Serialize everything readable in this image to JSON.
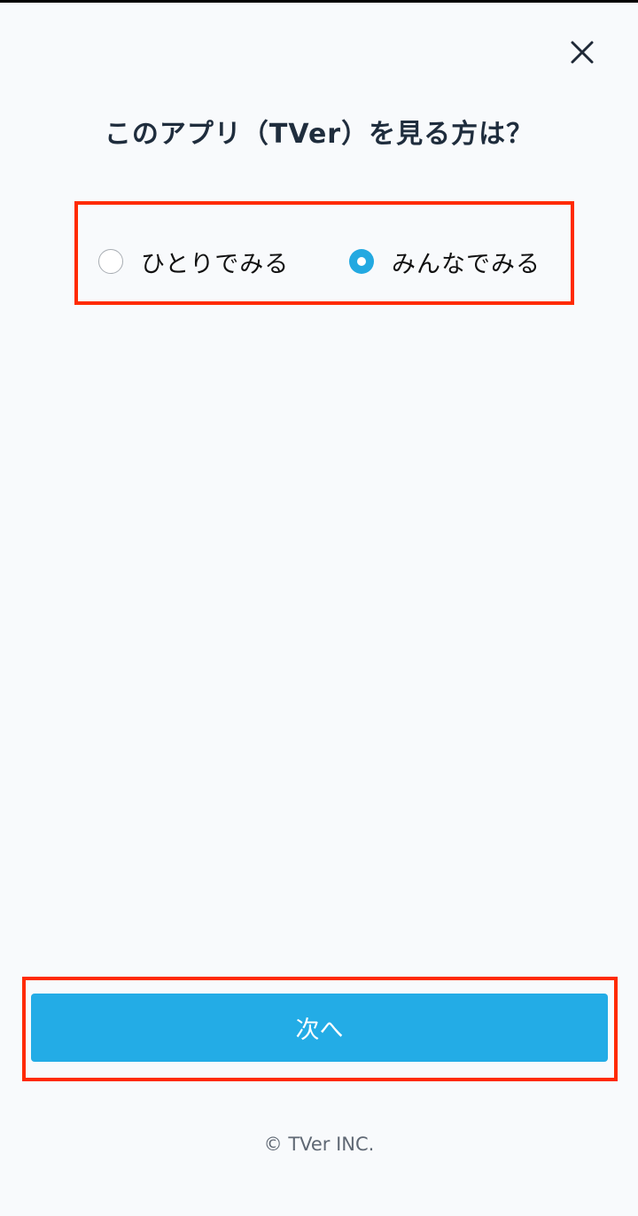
{
  "header": {
    "close_icon": "close-icon"
  },
  "title": "このアプリ（TVer）を見る方は？",
  "options": [
    {
      "label": "ひとりでみる",
      "selected": false
    },
    {
      "label": "みんなでみる",
      "selected": true
    }
  ],
  "next_button": {
    "label": "次へ"
  },
  "footer": {
    "copyright": "© TVer INC."
  },
  "colors": {
    "accent": "#23ace6",
    "highlight_frame": "#ff2a00",
    "background": "#f8fafc"
  }
}
